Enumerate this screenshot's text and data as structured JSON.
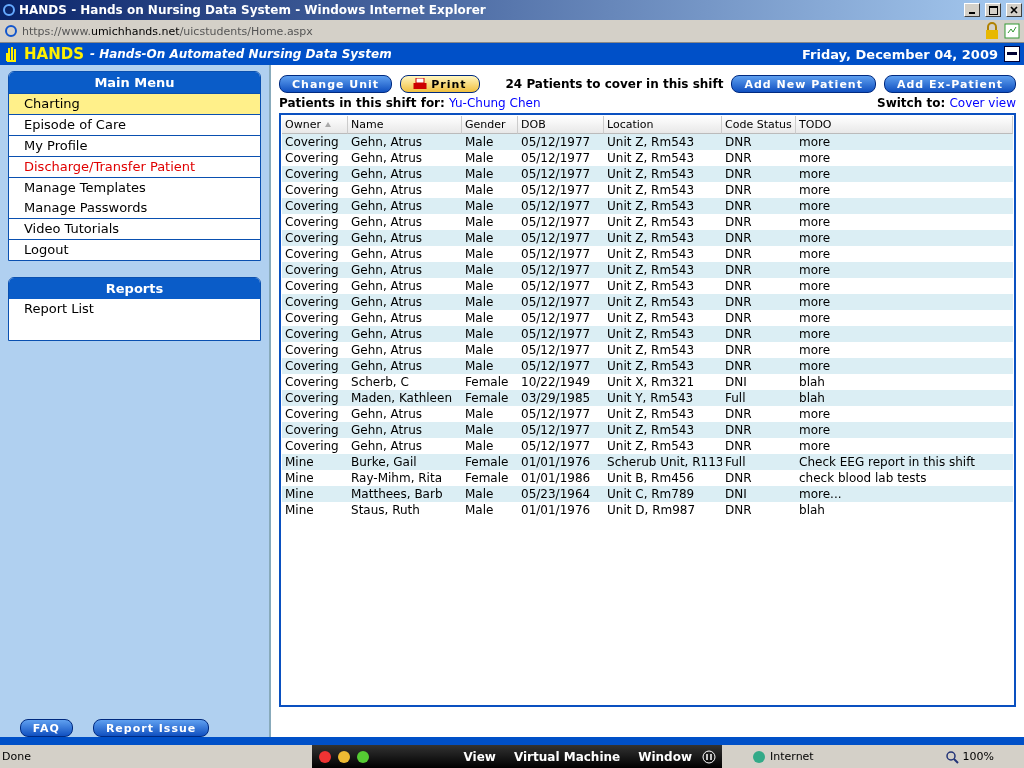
{
  "window": {
    "title": "HANDS - Hands on Nursing Data System - Windows Internet Explorer"
  },
  "address_bar": {
    "url_prefix": "https://www.",
    "url_domain": "umichhands.net",
    "url_path": "/uicstudents/Home.aspx"
  },
  "header": {
    "logo": "HANDS",
    "subtitle": "- Hands-On Automated Nursing Data System",
    "date": "Friday, December 04, 2009"
  },
  "main_menu": {
    "title": "Main Menu",
    "groups": [
      [
        {
          "label": "Charting",
          "selected": true,
          "kind": "normal"
        }
      ],
      [
        {
          "label": "Episode of Care",
          "selected": false,
          "kind": "normal"
        }
      ],
      [
        {
          "label": "My Profile",
          "selected": false,
          "kind": "normal"
        }
      ],
      [
        {
          "label": "Discharge/Transfer Patient",
          "selected": false,
          "kind": "alert"
        }
      ],
      [
        {
          "label": "Manage Templates",
          "selected": false,
          "kind": "normal"
        },
        {
          "label": "Manage Passwords",
          "selected": false,
          "kind": "normal"
        }
      ],
      [
        {
          "label": "Video Tutorials",
          "selected": false,
          "kind": "normal"
        }
      ],
      [
        {
          "label": "Logout",
          "selected": false,
          "kind": "normal"
        }
      ]
    ]
  },
  "reports": {
    "title": "Reports",
    "items": [
      "Report List"
    ]
  },
  "sidebar_buttons": [
    "FAQ",
    "Report Issue"
  ],
  "toolbar": {
    "change_unit": "Change Unit",
    "print": "Print",
    "patient_count": "24 Patients to cover in this shift",
    "add_new": "Add New Patient",
    "add_ex": "Add Ex-Patient"
  },
  "shift": {
    "label": "Patients in this shift for:",
    "nurse": "Yu-Chung Chen",
    "switch_label": "Switch to:",
    "switch_link": "Cover view"
  },
  "table": {
    "columns": [
      "Owner",
      "Name",
      "Gender",
      "DOB",
      "Location",
      "Code Status",
      "TODO"
    ],
    "rows": [
      [
        "Covering",
        "Gehn, Atrus",
        "Male",
        "05/12/1977",
        "Unit Z, Rm543",
        "DNR",
        "more"
      ],
      [
        "Covering",
        "Gehn, Atrus",
        "Male",
        "05/12/1977",
        "Unit Z, Rm543",
        "DNR",
        "more"
      ],
      [
        "Covering",
        "Gehn, Atrus",
        "Male",
        "05/12/1977",
        "Unit Z, Rm543",
        "DNR",
        "more"
      ],
      [
        "Covering",
        "Gehn, Atrus",
        "Male",
        "05/12/1977",
        "Unit Z, Rm543",
        "DNR",
        "more"
      ],
      [
        "Covering",
        "Gehn, Atrus",
        "Male",
        "05/12/1977",
        "Unit Z, Rm543",
        "DNR",
        "more"
      ],
      [
        "Covering",
        "Gehn, Atrus",
        "Male",
        "05/12/1977",
        "Unit Z, Rm543",
        "DNR",
        "more"
      ],
      [
        "Covering",
        "Gehn, Atrus",
        "Male",
        "05/12/1977",
        "Unit Z, Rm543",
        "DNR",
        "more"
      ],
      [
        "Covering",
        "Gehn, Atrus",
        "Male",
        "05/12/1977",
        "Unit Z, Rm543",
        "DNR",
        "more"
      ],
      [
        "Covering",
        "Gehn, Atrus",
        "Male",
        "05/12/1977",
        "Unit Z, Rm543",
        "DNR",
        "more"
      ],
      [
        "Covering",
        "Gehn, Atrus",
        "Male",
        "05/12/1977",
        "Unit Z, Rm543",
        "DNR",
        "more"
      ],
      [
        "Covering",
        "Gehn, Atrus",
        "Male",
        "05/12/1977",
        "Unit Z, Rm543",
        "DNR",
        "more"
      ],
      [
        "Covering",
        "Gehn, Atrus",
        "Male",
        "05/12/1977",
        "Unit Z, Rm543",
        "DNR",
        "more"
      ],
      [
        "Covering",
        "Gehn, Atrus",
        "Male",
        "05/12/1977",
        "Unit Z, Rm543",
        "DNR",
        "more"
      ],
      [
        "Covering",
        "Gehn, Atrus",
        "Male",
        "05/12/1977",
        "Unit Z, Rm543",
        "DNR",
        "more"
      ],
      [
        "Covering",
        "Gehn, Atrus",
        "Male",
        "05/12/1977",
        "Unit Z, Rm543",
        "DNR",
        "more"
      ],
      [
        "Covering",
        "Scherb, C",
        "Female",
        "10/22/1949",
        "Unit X, Rm321",
        "DNI",
        "blah"
      ],
      [
        "Covering",
        "Maden, Kathleen",
        "Female",
        "03/29/1985",
        "Unit Y, Rm543",
        "Full",
        "blah"
      ],
      [
        "Covering",
        "Gehn, Atrus",
        "Male",
        "05/12/1977",
        "Unit Z, Rm543",
        "DNR",
        "more"
      ],
      [
        "Covering",
        "Gehn, Atrus",
        "Male",
        "05/12/1977",
        "Unit Z, Rm543",
        "DNR",
        "more"
      ],
      [
        "Covering",
        "Gehn, Atrus",
        "Male",
        "05/12/1977",
        "Unit Z, Rm543",
        "DNR",
        "more"
      ],
      [
        "Mine",
        "Burke, Gail",
        "Female",
        "01/01/1976",
        "Scherub Unit, R113",
        "Full",
        "Check EEG report in this shift"
      ],
      [
        "Mine",
        "Ray-Mihm, Rita",
        "Female",
        "01/01/1986",
        "Unit B, Rm456",
        "DNR",
        "check blood lab tests"
      ],
      [
        "Mine",
        "Matthees, Barb",
        "Male",
        "05/23/1964",
        "Unit C, Rm789",
        "DNI",
        "more..."
      ],
      [
        "Mine",
        "Staus, Ruth",
        "Male",
        "01/01/1976",
        "Unit D, Rm987",
        "DNR",
        "blah"
      ]
    ]
  },
  "status_bar": {
    "text": "Done",
    "vm_menu": [
      "View",
      "Virtual Machine",
      "Window"
    ],
    "zone": "Internet",
    "zoom": "100%"
  }
}
